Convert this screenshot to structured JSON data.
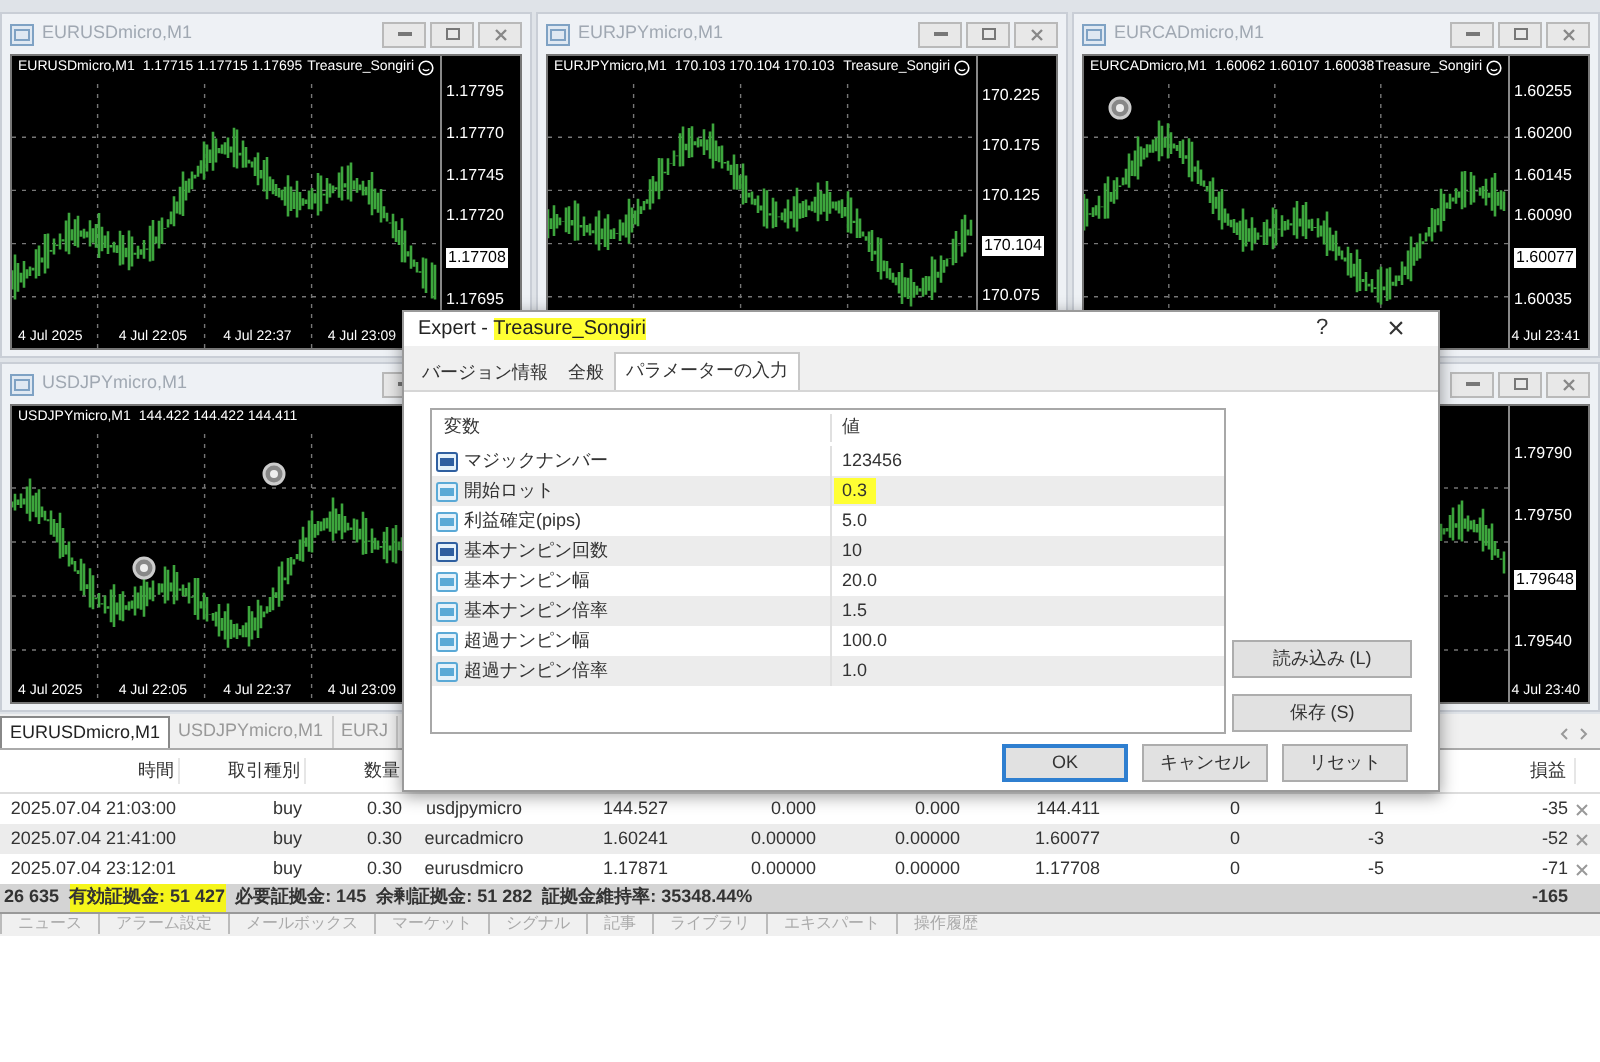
{
  "charts": [
    {
      "title": "EURUSDmicro,M1",
      "symbol": "EURUSDmicro,M1",
      "ohlc": "1.17715 1.17715 1.17695",
      "expert": "Treasure_Songiri",
      "price_labels": [
        {
          "text": "1.17795",
          "kind": "tick"
        },
        {
          "text": "1.17770",
          "kind": "tick"
        },
        {
          "text": "1.17745",
          "kind": "tick"
        },
        {
          "text": "1.17720",
          "kind": "tick"
        },
        {
          "text": "1.17708",
          "kind": "current"
        },
        {
          "text": "1.17695",
          "kind": "tick"
        }
      ],
      "time_labels": [
        "4 Jul 2025",
        "4 Jul 22:05",
        "4 Jul 22:37",
        "4 Jul 23:09"
      ]
    },
    {
      "title": "EURJPYmicro,M1",
      "symbol": "EURJPYmicro,M1",
      "ohlc": "170.103 170.104 170.103",
      "expert": "Treasure_Songiri",
      "price_labels": [
        {
          "text": "170.225",
          "kind": "tick"
        },
        {
          "text": "170.175",
          "kind": "tick"
        },
        {
          "text": "170.125",
          "kind": "tick"
        },
        {
          "text": "170.104",
          "kind": "current"
        },
        {
          "text": "170.075",
          "kind": "tick"
        }
      ]
    },
    {
      "title": "EURCADmicro,M1",
      "symbol": "EURCADmicro,M1",
      "ohlc": "1.60062 1.60107 1.60038",
      "expert": "Treasure_Songiri",
      "price_labels": [
        {
          "text": "1.60255",
          "kind": "tick"
        },
        {
          "text": "1.60200",
          "kind": "tick"
        },
        {
          "text": "1.60145",
          "kind": "tick"
        },
        {
          "text": "1.60090",
          "kind": "tick"
        },
        {
          "text": "1.60077",
          "kind": "current"
        },
        {
          "text": "1.60035",
          "kind": "tick"
        }
      ],
      "time_labels": [
        "4 Jul 23:41"
      ]
    },
    {
      "title": "USDJPYmicro,M1",
      "symbol": "USDJPYmicro,M1",
      "ohlc": "144.422 144.422 144.411",
      "time_labels": [
        "4 Jul 2025",
        "4 Jul 22:05",
        "4 Jul 22:37",
        "4 Jul 23:09"
      ]
    },
    {
      "price_labels": [
        {
          "text": "1.79790",
          "kind": "tick"
        },
        {
          "text": "1.79750",
          "kind": "tick"
        },
        {
          "text": "1.79648",
          "kind": "current"
        },
        {
          "text": "1.79540",
          "kind": "tick"
        }
      ],
      "time_labels": [
        "4 Jul 23:40"
      ]
    }
  ],
  "terminal": {
    "tabs": [
      {
        "label": "EURUSDmicro,M1",
        "selected": true
      },
      {
        "label": "USDJPYmicro,M1",
        "selected": false
      },
      {
        "label": "EURJ",
        "selected": false
      }
    ],
    "columns": [
      "時間",
      "取引種別",
      "数量",
      "",
      "",
      "",
      "",
      "",
      "",
      "",
      "損益"
    ],
    "rows": [
      {
        "cells": [
          "2025.07.04 21:03:00",
          "buy",
          "0.30",
          "usdjpymicro",
          "144.527",
          "0.000",
          "0.000",
          "144.411",
          "0",
          "1",
          "-35"
        ]
      },
      {
        "cells": [
          "2025.07.04 21:41:00",
          "buy",
          "0.30",
          "eurcadmicro",
          "1.60241",
          "0.00000",
          "0.00000",
          "1.60077",
          "0",
          "-3",
          "-52"
        ]
      },
      {
        "cells": [
          "2025.07.04 23:12:01",
          "buy",
          "0.30",
          "eurusdmicro",
          "1.17871",
          "0.00000",
          "0.00000",
          "1.17708",
          "0",
          "-5",
          "-71"
        ]
      }
    ],
    "status": [
      {
        "text": "26 635",
        "highlighted": false
      },
      {
        "text": "有効証拠金: 51 427",
        "highlighted": true
      },
      {
        "text": "必要証拠金: 145",
        "highlighted": false
      },
      {
        "text": "余剰証拠金: 51 282",
        "highlighted": false
      },
      {
        "text": "証拠金維持率: 35348.44%",
        "highlighted": false
      }
    ],
    "total": "-165",
    "bottom_tabs": [
      "ニュース",
      "アラーム設定",
      "メールボックス",
      "マーケット",
      "シグナル",
      "記事",
      "ライブラリ",
      "エキスパート",
      "操作履歴"
    ]
  },
  "dialog": {
    "title_prefix": "Expert - ",
    "title_name": "Treasure_Songiri",
    "title_highlighted": true,
    "help": "?",
    "close": "×",
    "tabs": [
      {
        "label": "バージョン情報",
        "selected": false
      },
      {
        "label": "全般",
        "selected": false
      },
      {
        "label": "パラメーターの入力",
        "selected": true
      }
    ],
    "columns": [
      "変数",
      "値"
    ],
    "params": [
      {
        "name": "マジックナンバー",
        "value": "123456",
        "kind": "int",
        "highlighted": false
      },
      {
        "name": "開始ロット",
        "value": "0.3",
        "kind": "double",
        "highlighted": true
      },
      {
        "name": "利益確定(pips)",
        "value": "5.0",
        "kind": "double",
        "highlighted": false
      },
      {
        "name": "基本ナンピン回数",
        "value": "10",
        "kind": "int",
        "highlighted": false
      },
      {
        "name": "基本ナンピン幅",
        "value": "20.0",
        "kind": "double",
        "highlighted": false
      },
      {
        "name": "基本ナンピン倍率",
        "value": "1.5",
        "kind": "double",
        "highlighted": false
      },
      {
        "name": "超過ナンピン幅",
        "value": "100.0",
        "kind": "double",
        "highlighted": false
      },
      {
        "name": "超過ナンピン倍率",
        "value": "1.0",
        "kind": "double",
        "highlighted": false
      }
    ],
    "side_buttons": [
      "読み込み (L)",
      "保存 (S)"
    ],
    "buttons": [
      {
        "label": "OK",
        "default": true
      },
      {
        "label": "キャンセル",
        "default": false
      },
      {
        "label": "リセット",
        "default": false
      }
    ]
  }
}
